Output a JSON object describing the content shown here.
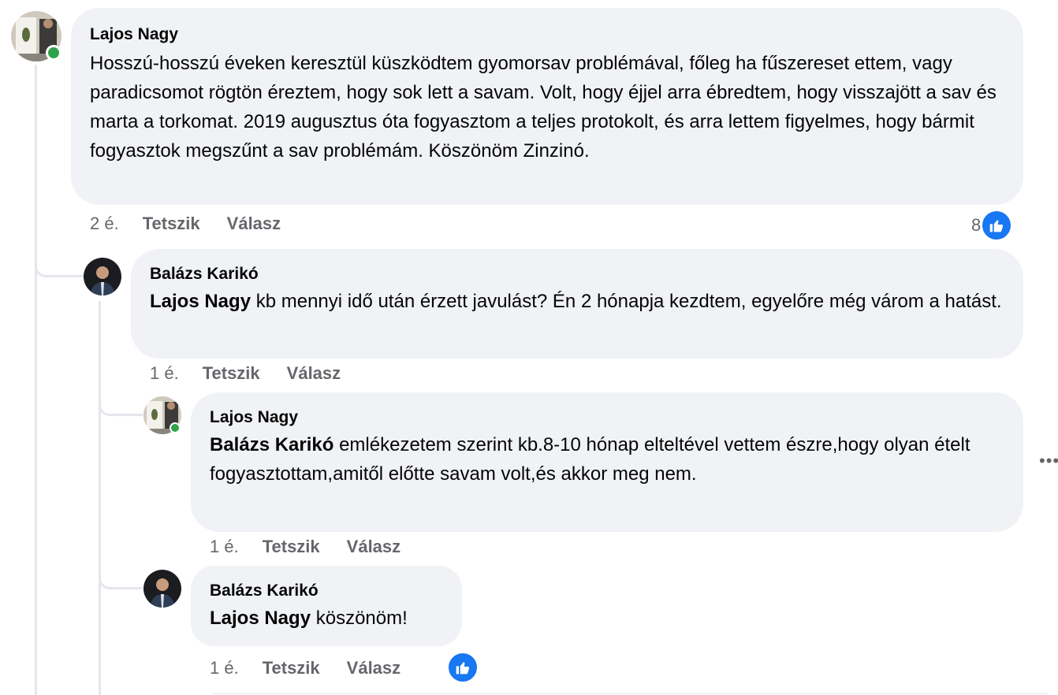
{
  "comments": [
    {
      "author": "Lajos Nagy",
      "text": "Hosszú-hosszú éveken keresztül küszködtem gyomorsav problémával, főleg ha fűszereset ettem, vagy paradicsomot rögtön éreztem, hogy sok lett a savam. Volt, hogy éjjel arra ébredtem, hogy visszajött a sav és marta a torkomat. 2019 augusztus óta fogyasztom a teljes protokolt, és arra lettem figyelmes, hogy bármit fogyasztok megszűnt a sav problémám. Köszönöm Zinzinó.",
      "time": "2 é.",
      "like_label": "Tetszik",
      "reply_label": "Válasz",
      "reaction_count": "8",
      "online": true
    },
    {
      "author": "Balázs Karikó",
      "mention": "Lajos Nagy",
      "text": " kb mennyi idő után érzett javulást? Én 2 hónapja kezdtem, egyelőre még várom a hatást.",
      "time": "1 é.",
      "like_label": "Tetszik",
      "reply_label": "Válasz"
    },
    {
      "author": "Lajos Nagy",
      "mention": "Balázs Karikó",
      "text": " emlékezetem szerint kb.8-10 hónap elteltével vettem észre,hogy olyan ételt fogyasztottam,amitől előtte savam volt,és akkor meg nem.",
      "time": "1 é.",
      "like_label": "Tetszik",
      "reply_label": "Válasz",
      "online": true,
      "more_icon": "more-horizontal-icon"
    },
    {
      "author": "Balázs Karikó",
      "mention": "Lajos Nagy",
      "text": " köszönöm!",
      "time": "1 é.",
      "like_label": "Tetszik",
      "reply_label": "Válasz",
      "reaction_icon": "like-thumb-icon"
    }
  ],
  "colors": {
    "bubble": "#f0f2f5",
    "accent": "#1877f2",
    "online": "#31a24c",
    "meta": "#65676b"
  }
}
